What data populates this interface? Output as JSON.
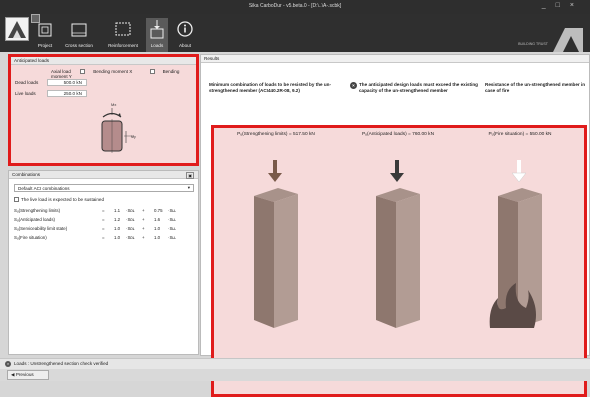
{
  "app": {
    "title": "Sika CarboDur - v5.beta.0 - [D:\\..\\A-.scbk]"
  },
  "ribbon": {
    "tabs": [
      {
        "label": "Project",
        "icon": "project-icon"
      },
      {
        "label": "Cross section",
        "icon": "cross-section-icon"
      },
      {
        "label": "Reinforcement",
        "icon": "reinforcement-icon"
      },
      {
        "label": "Loads",
        "icon": "loads-icon"
      },
      {
        "label": "About",
        "icon": "info-icon"
      }
    ],
    "active_tab": "Loads",
    "brand_text": "BUILDING TRUST"
  },
  "anticipated": {
    "title": "Anticipated loads",
    "axial_label": "Axial load",
    "moment_x_label": "Bending moment X",
    "moment_y_label": "Bending moment Y",
    "dead_label": "Dead loads",
    "dead_value": "500.0 kN",
    "live_label": "Live loads",
    "live_value": "250.0 kN",
    "diagram_top_label": "Mx",
    "diagram_side_label": "My"
  },
  "combinations": {
    "title": "Combinations",
    "selected": "Default ACI combinations",
    "sustain_label": "The live load is expected to be sustained",
    "rows": [
      {
        "label": "Sᵤ(Strengthening limits)",
        "f1": "1.1",
        "t1": "·Sᴅʟ",
        "f2": "0.75",
        "t2": "·Sʟʟ"
      },
      {
        "label": "Sᵤ(Anticipated loads)",
        "f1": "1.2",
        "t1": "·Sᴅʟ",
        "f2": "1.6",
        "t2": "·Sʟʟ"
      },
      {
        "label": "Sᵤ(Serviceability limit state)",
        "f1": "1.0",
        "t1": "·Sᴅʟ",
        "f2": "1.0",
        "t2": "·Sʟʟ"
      },
      {
        "label": "Sᵤ(Fire situation)",
        "f1": "1.0",
        "t1": "·Sᴅʟ",
        "f2": "1.0",
        "t2": "·Sʟʟ"
      }
    ]
  },
  "results": {
    "title": "Results",
    "heading1": "Minimum combination of loads to be resisted by the un-strengthened member (ACI440.2R-08, 9.2)",
    "heading2": "The anticipated design loads must exceed the existing capacity of the un-strengthened member",
    "heading3": "Resistance of the un-strengthened member in case of fire",
    "columns": [
      {
        "label": "Pᵤ(Strengthening limits) = 517.50 kN",
        "result": "ϕPₙ = 1464.07 → kN"
      },
      {
        "label": "Pᵤ(Anticipated loads) = 760.00 kN",
        "result": "ϕPₙ = 1464.07 → kN"
      },
      {
        "label": "Pᵤ(Fire situation) = 550.00 kN",
        "result": "ϕPₙ = 2252.42 → kN"
      }
    ]
  },
  "status": {
    "text": "Loads : Unstrengthened section check verified"
  },
  "nav": {
    "previous_label": "Previous"
  }
}
